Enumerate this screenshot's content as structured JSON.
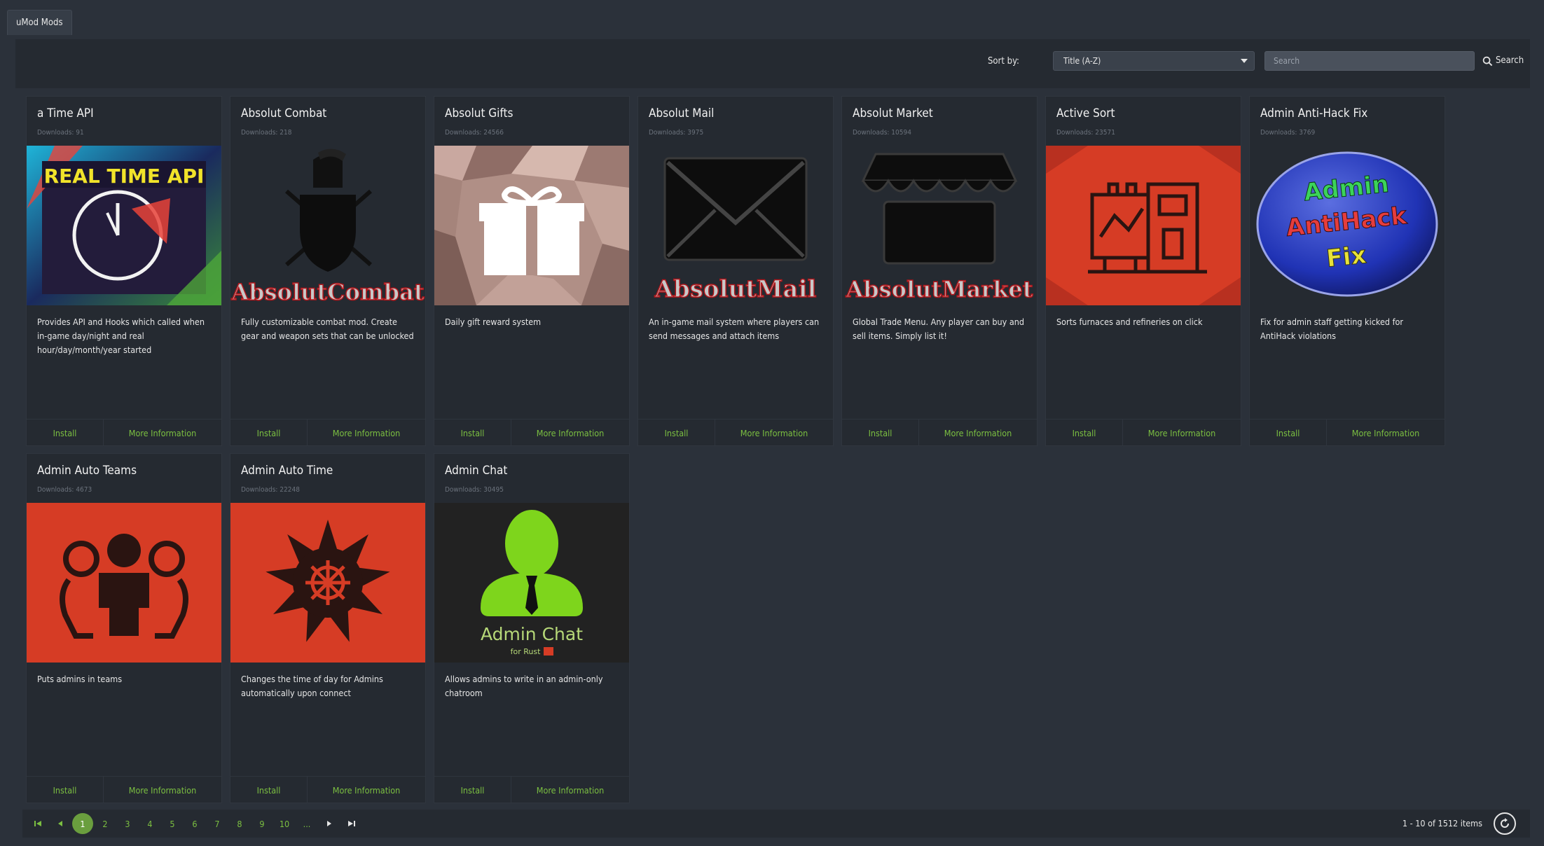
{
  "tab": {
    "label": "uMod Mods"
  },
  "toolbar": {
    "sort_label": "Sort by:",
    "sort_value": "Title (A-Z)",
    "search_placeholder": "Search",
    "search_button": "Search"
  },
  "colors": {
    "accent": "#7bbf41",
    "background": "#2b313a",
    "card": "#252a31",
    "active_page": "#6a9e3e"
  },
  "cards": [
    {
      "title": "a Time API",
      "downloads": "Downloads: 91",
      "description": "Provides API and Hooks which called when in-game day/night and real hour/day/month/year started",
      "install": "Install",
      "more": "More Information",
      "image": "real-time-api-logo",
      "image_text": "REAL TIME API"
    },
    {
      "title": "Absolut Combat",
      "downloads": "Downloads: 218",
      "description": "Fully customizable combat mod. Create gear and weapon sets that can be unlocked",
      "install": "Install",
      "more": "More Information",
      "image": "spartan-helmet-shield-icon",
      "image_text": "AbsolutCombat"
    },
    {
      "title": "Absolut Gifts",
      "downloads": "Downloads: 24566",
      "description": "Daily gift reward system",
      "install": "Install",
      "more": "More Information",
      "image": "gift-box-icon"
    },
    {
      "title": "Absolut Mail",
      "downloads": "Downloads: 3975",
      "description": "An in-game mail system where players can send messages and attach items",
      "install": "Install",
      "more": "More Information",
      "image": "envelope-icon",
      "image_text": "AbsolutMail"
    },
    {
      "title": "Absolut Market",
      "downloads": "Downloads: 10594",
      "description": "Global Trade Menu. Any player can buy and sell items. Simply list it!",
      "install": "Install",
      "more": "More Information",
      "image": "storefront-icon",
      "image_text": "AbsolutMarket"
    },
    {
      "title": "Active Sort",
      "downloads": "Downloads: 23571",
      "description": "Sorts furnaces and refineries on click",
      "install": "Install",
      "more": "More Information",
      "image": "furnace-icon"
    },
    {
      "title": "Admin Anti-Hack Fix",
      "downloads": "Downloads: 3769",
      "description": "Fix for admin staff getting kicked for AntiHack violations",
      "install": "Install",
      "more": "More Information",
      "image": "antihack-badge",
      "image_text_1": "Admin",
      "image_text_2": "AntiHack",
      "image_text_3": "Fix"
    },
    {
      "title": "Admin Auto Teams",
      "downloads": "Downloads: 4673",
      "description": "Puts admins in teams",
      "install": "Install",
      "more": "More Information",
      "image": "team-people-icon"
    },
    {
      "title": "Admin Auto Time",
      "downloads": "Downloads: 22248",
      "description": "Changes the time of day for Admins automatically upon connect",
      "install": "Install",
      "more": "More Information",
      "image": "sun-icon"
    },
    {
      "title": "Admin Chat",
      "downloads": "Downloads: 30495",
      "description": "Allows admins to write in an admin-only chatroom",
      "install": "Install",
      "more": "More Information",
      "image": "admin-person-icon",
      "image_text_1": "Admin Chat",
      "image_text_2": "for Rust"
    }
  ],
  "pager": {
    "pages": [
      "1",
      "2",
      "3",
      "4",
      "5",
      "6",
      "7",
      "8",
      "9",
      "10",
      "..."
    ],
    "active_page": "1",
    "info": "1 - 10 of 1512 items"
  }
}
